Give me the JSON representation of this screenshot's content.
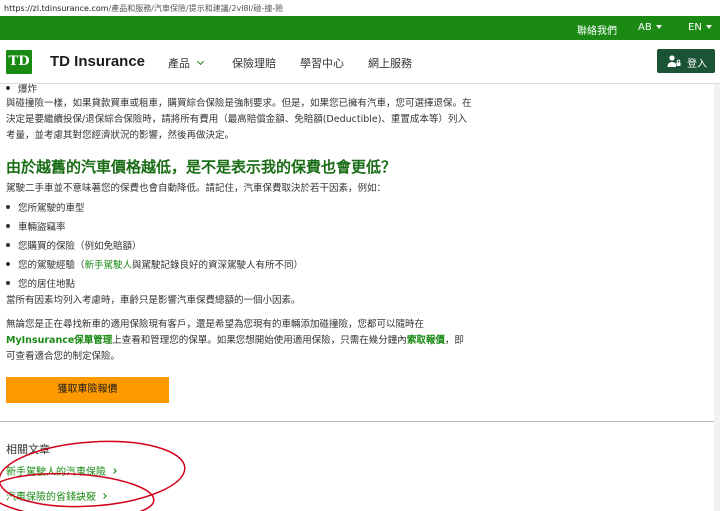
{
  "browser": {
    "url_host": "https://zl.tdinsurance.com",
    "url_path": "/產品和服務/汽車保險/提示和建議/2vl8l/碰-撞-險"
  },
  "topbar": {
    "contact": "聯絡我們",
    "province": "AB",
    "language": "EN"
  },
  "nav": {
    "brand": "TD Insurance",
    "logo_text": "TD",
    "items": [
      "產品",
      "保險理賠",
      "學習中心",
      "網上服務"
    ],
    "login": "登入"
  },
  "article": {
    "top_bullet": "爆炸",
    "para1": "與碰撞險一樣，如果貸款買車或租車，購買綜合保險是強制要求。但是，如果您已擁有汽車，您可選擇退保。在決定是要繼續投保/退保綜合保險時，請將所有費用（最高賠償金額、免賠額(Deductible)、重置成本等）列入考量，並考慮其對您經濟狀況的影響，然後再做決定。",
    "heading": "由於越舊的汽車價格越低，是不是表示我的保費也會更低？",
    "intro": "駕駛二手車並不意味著您的保費也會自動降低。請記住，汽車保費取決於若干因素，例如：",
    "factors": [
      "您所駕駛的車型",
      "車輛盜竊率",
      "您購買的保險（例如免賠額）"
    ],
    "factor4_pre": "您的駕駛經驗（",
    "factor4_link": "新手駕駛人",
    "factor4_post": "與駕駛記錄良好的資深駕駛人有所不同）",
    "factor5": "您的居住地點",
    "summary": "當所有因素均列入考慮時，車齡只是影響汽車保費總額的一個小因素。",
    "para3_a": "無論您是正在尋找新車的適用保險現有客戶，還是希望為您現有的車輛添加碰撞險，您都可以隨時在",
    "para3_link1": "MyInsurance保單管理",
    "para3_b": "上查看和管理您的保單。如果您想開始使用適用保險，只需在幾分鐘內",
    "para3_link2": "索取報價",
    "para3_c": "，即可查看適合您的制定保險。",
    "cta": "獲取車險報價"
  },
  "related": {
    "title": "相關文章",
    "links": [
      "新手駕駛人的汽車保險",
      "汽車保險的省錢訣竅"
    ]
  },
  "colors": {
    "brand_green": "#1a8a15",
    "dark_green": "#1a5336",
    "cta_orange": "#ff9900",
    "annotation_red": "#d0021b"
  }
}
